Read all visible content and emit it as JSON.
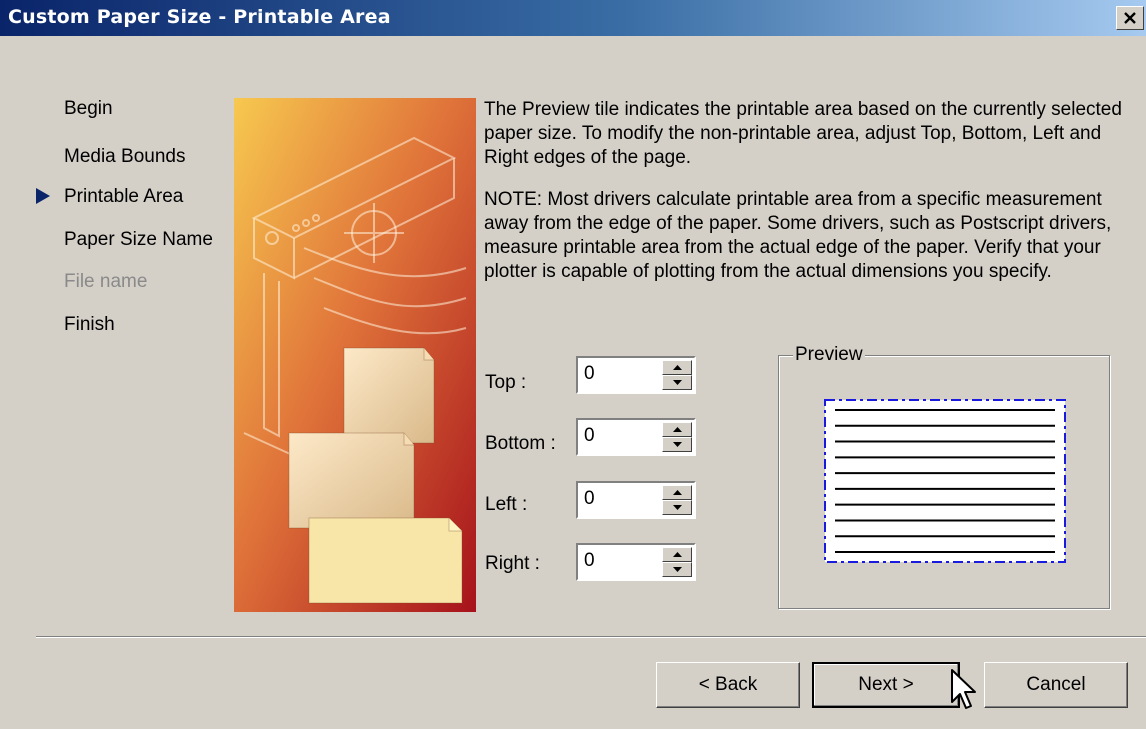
{
  "window": {
    "title": "Custom Paper Size - Printable Area",
    "close_label": "X"
  },
  "steps": [
    {
      "label": "Begin",
      "state": "normal"
    },
    {
      "label": "Media Bounds",
      "state": "normal"
    },
    {
      "label": "Printable Area",
      "state": "current"
    },
    {
      "label": "Paper Size Name",
      "state": "normal"
    },
    {
      "label": "File name",
      "state": "disabled"
    },
    {
      "label": "Finish",
      "state": "normal"
    }
  ],
  "description": {
    "paragraph1": "The Preview tile indicates the printable area based on the currently selected paper size. To modify the non-printable area, adjust Top, Bottom, Left and Right edges of the page.",
    "paragraph2": "NOTE: Most drivers calculate printable area from a specific measurement away from the edge of the paper. Some drivers, such as Postscript drivers, measure printable area from the actual edge of the paper. Verify that your plotter is capable of plotting from the actual dimensions you specify."
  },
  "fields": {
    "top": {
      "label": "Top :",
      "value": "0"
    },
    "bottom": {
      "label": "Bottom :",
      "value": "0"
    },
    "left": {
      "label": "Left :",
      "value": "0"
    },
    "right": {
      "label": "Right :",
      "value": "0"
    }
  },
  "preview": {
    "label": "Preview",
    "line_count": 10
  },
  "buttons": {
    "back": "< Back",
    "next": "Next >",
    "cancel": "Cancel"
  },
  "icons": {
    "close": "close-icon",
    "current_step": "current-step-arrow-icon",
    "spin_up": "spin-up-arrow-icon",
    "spin_down": "spin-down-arrow-icon",
    "cursor": "mouse-pointer-icon",
    "banner": "plotter-illustration"
  },
  "colors": {
    "title_start": "#0a246a",
    "title_end": "#a6caf0",
    "dialog_bg": "#d4d0c8",
    "step_arrow": "#0a246a",
    "preview_border": "#1a1adf"
  }
}
